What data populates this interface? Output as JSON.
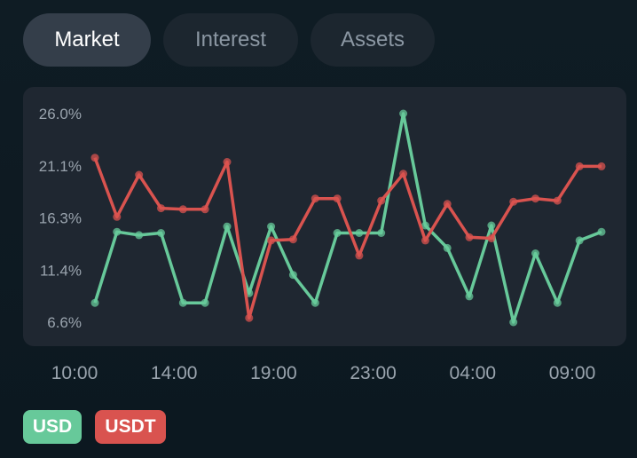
{
  "tabs": [
    {
      "label": "Market",
      "active": true
    },
    {
      "label": "Interest",
      "active": false
    },
    {
      "label": "Assets",
      "active": false
    }
  ],
  "colors": {
    "usd": "#67c99a",
    "usdt": "#d9534f"
  },
  "chart_data": {
    "type": "line",
    "y_ticks": [
      "26.0%",
      "21.1%",
      "16.3%",
      "11.4%",
      "6.6%"
    ],
    "ylim": [
      6.6,
      26.0
    ],
    "x_tick_labels": [
      "10:00",
      "14:00",
      "19:00",
      "23:00",
      "04:00",
      "09:00"
    ],
    "grid": false,
    "legend_position": "bottom-left",
    "series": [
      {
        "name": "USD",
        "values": [
          8.4,
          15.0,
          14.7,
          14.9,
          8.4,
          8.4,
          15.5,
          9.3,
          15.5,
          11.0,
          8.4,
          14.9,
          14.9,
          14.9,
          26.0,
          15.6,
          13.5,
          9.0,
          15.6,
          6.6,
          13.0,
          8.4,
          14.2,
          15.0
        ]
      },
      {
        "name": "USDT",
        "values": [
          21.9,
          16.4,
          20.3,
          17.2,
          17.1,
          17.1,
          21.5,
          7.0,
          14.2,
          14.3,
          18.1,
          18.1,
          12.8,
          17.9,
          20.4,
          14.2,
          17.6,
          14.5,
          14.4,
          17.8,
          18.1,
          17.9,
          21.1,
          21.1
        ]
      }
    ]
  }
}
